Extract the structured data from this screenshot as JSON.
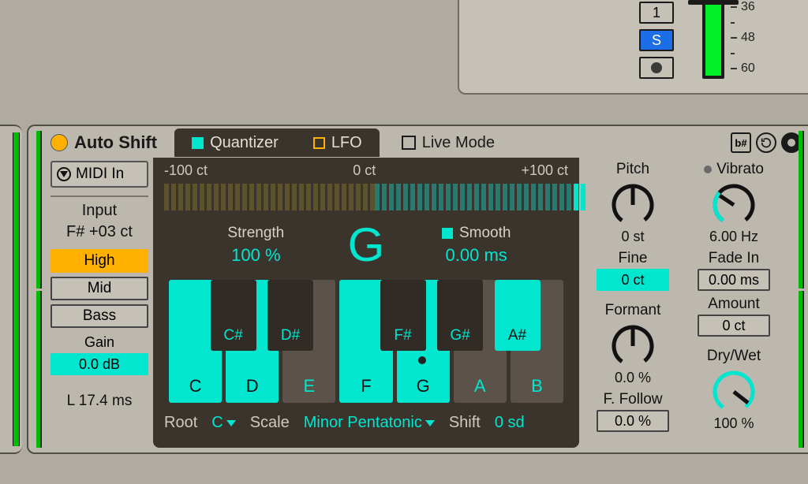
{
  "top_mixer": {
    "button1": "1",
    "solo": "S",
    "scale": [
      "36",
      "48",
      "60"
    ]
  },
  "device": {
    "name": "Auto Shift",
    "tabs": {
      "quantizer": "Quantizer",
      "lfo": "LFO"
    },
    "live_mode": "Live Mode",
    "midi_in": "MIDI In",
    "input_header": "Input",
    "input_detected": "F# +03 ct",
    "range_options": [
      "High",
      "Mid",
      "Bass"
    ],
    "range_selected": 0,
    "gain_label": "Gain",
    "gain_value": "0.0 dB",
    "latency": "L 17.4 ms",
    "cents": {
      "min": "-100 ct",
      "mid": "0 ct",
      "max": "+100 ct"
    },
    "strength_label": "Strength",
    "strength_value": "100 %",
    "detected_note": "G",
    "smooth_label": "Smooth",
    "smooth_value": "0.00 ms",
    "keys": {
      "white": [
        {
          "n": "C",
          "on": true
        },
        {
          "n": "D",
          "on": true
        },
        {
          "n": "E",
          "on": false
        },
        {
          "n": "F",
          "on": true
        },
        {
          "n": "G",
          "on": true
        },
        {
          "n": "A",
          "on": false
        },
        {
          "n": "B",
          "on": false
        }
      ],
      "black": [
        {
          "n": "C#",
          "on": false,
          "pos": 10.5
        },
        {
          "n": "D#",
          "on": false,
          "pos": 25.0
        },
        {
          "n": "F#",
          "on": false,
          "pos": 53.5
        },
        {
          "n": "G#",
          "on": false,
          "pos": 68.0
        },
        {
          "n": "A#",
          "on": true,
          "pos": 82.5
        }
      ]
    },
    "root_label": "Root",
    "root_value": "C",
    "scale_label": "Scale",
    "scale_value": "Minor Pentatonic",
    "shift_label": "Shift",
    "shift_value": "0 sd",
    "pitch": {
      "label": "Pitch",
      "value": "0 st",
      "fine_label": "Fine",
      "fine_value": "0 ct"
    },
    "formant": {
      "label": "Formant",
      "value": "0.0 %",
      "follow_label": "F. Follow",
      "follow_value": "0.0 %"
    },
    "vibrato": {
      "label": "Vibrato",
      "hz": "6.00 Hz",
      "fade_label": "Fade In",
      "fade_value": "0.00 ms",
      "amount_label": "Amount",
      "amount_value": "0 ct"
    },
    "drywet": {
      "label": "Dry/Wet",
      "value": "100 %"
    }
  }
}
